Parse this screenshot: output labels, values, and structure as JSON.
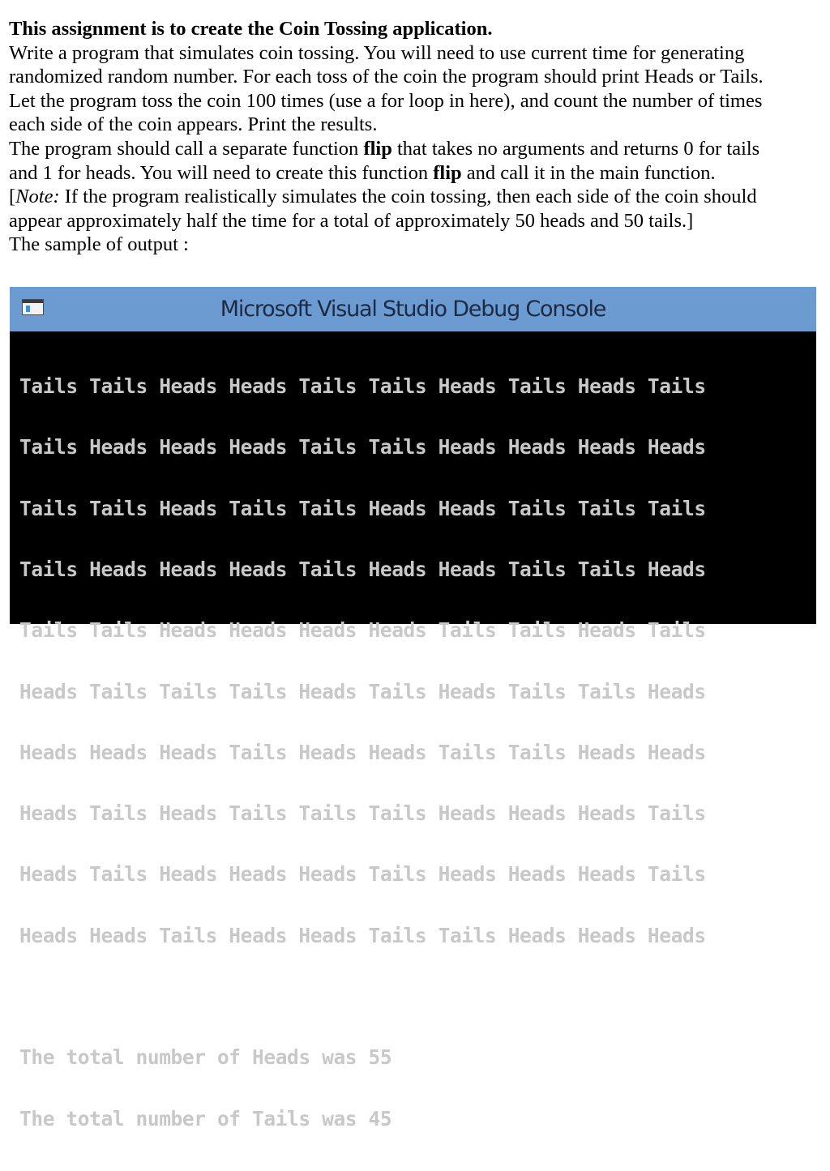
{
  "document": {
    "title": "This assignment is to create the Coin Tossing application.",
    "p1_l1": "Write a program that simulates coin tossing. You will need to use current time for generating",
    "p1_l2": "randomized random number. For each toss of the coin the program should print Heads or Tails.",
    "p1_l3": "Let the program toss the coin 100 times (use a for loop in here), and count the number of times",
    "p1_l4": "each side of the coin appears. Print the results.",
    "p2_l1_a": "The program should call a separate function ",
    "p2_l1_b": "flip",
    "p2_l1_c": " that takes no arguments and returns 0 for tails",
    "p2_l2_a": "and 1 for heads.  You will need to create this function ",
    "p2_l2_b": "flip",
    "p2_l2_c": " and call it in the main function.",
    "note_open": " [",
    "note_label": "Note:",
    "note_text": " If the program realistically simulates the coin tossing, then each side of the coin should",
    "note_l2": "appear approximately half the time for a total of approximately 50 heads and 50 tails.]",
    "sample_label": "The sample of output :"
  },
  "console": {
    "window_title": "Microsoft Visual Studio Debug Console",
    "icon": "console-app-icon",
    "title_bar_color": "#6b9bd1",
    "background_color": "#000000",
    "text_color": "#c8c8c8",
    "lines": [
      "Tails Tails Heads Heads Tails Tails Heads Tails Heads Tails",
      "Tails Heads Heads Heads Tails Tails Heads Heads Heads Heads",
      "Tails Tails Heads Tails Tails Heads Heads Tails Tails Tails",
      "Tails Heads Heads Heads Tails Heads Heads Tails Tails Heads",
      "Tails Tails Heads Heads Heads Heads Tails Tails Heads Tails",
      "Heads Tails Tails Tails Heads Tails Heads Tails Tails Heads",
      "Heads Heads Heads Tails Heads Heads Tails Tails Heads Heads",
      "Heads Tails Heads Tails Tails Tails Heads Heads Heads Tails",
      "Heads Tails Heads Heads Heads Tails Heads Heads Heads Tails",
      "Heads Heads Tails Heads Heads Tails Tails Heads Heads Heads"
    ],
    "total_heads": "The total number of Heads was 55",
    "total_tails": "The total number of Tails was 45"
  }
}
